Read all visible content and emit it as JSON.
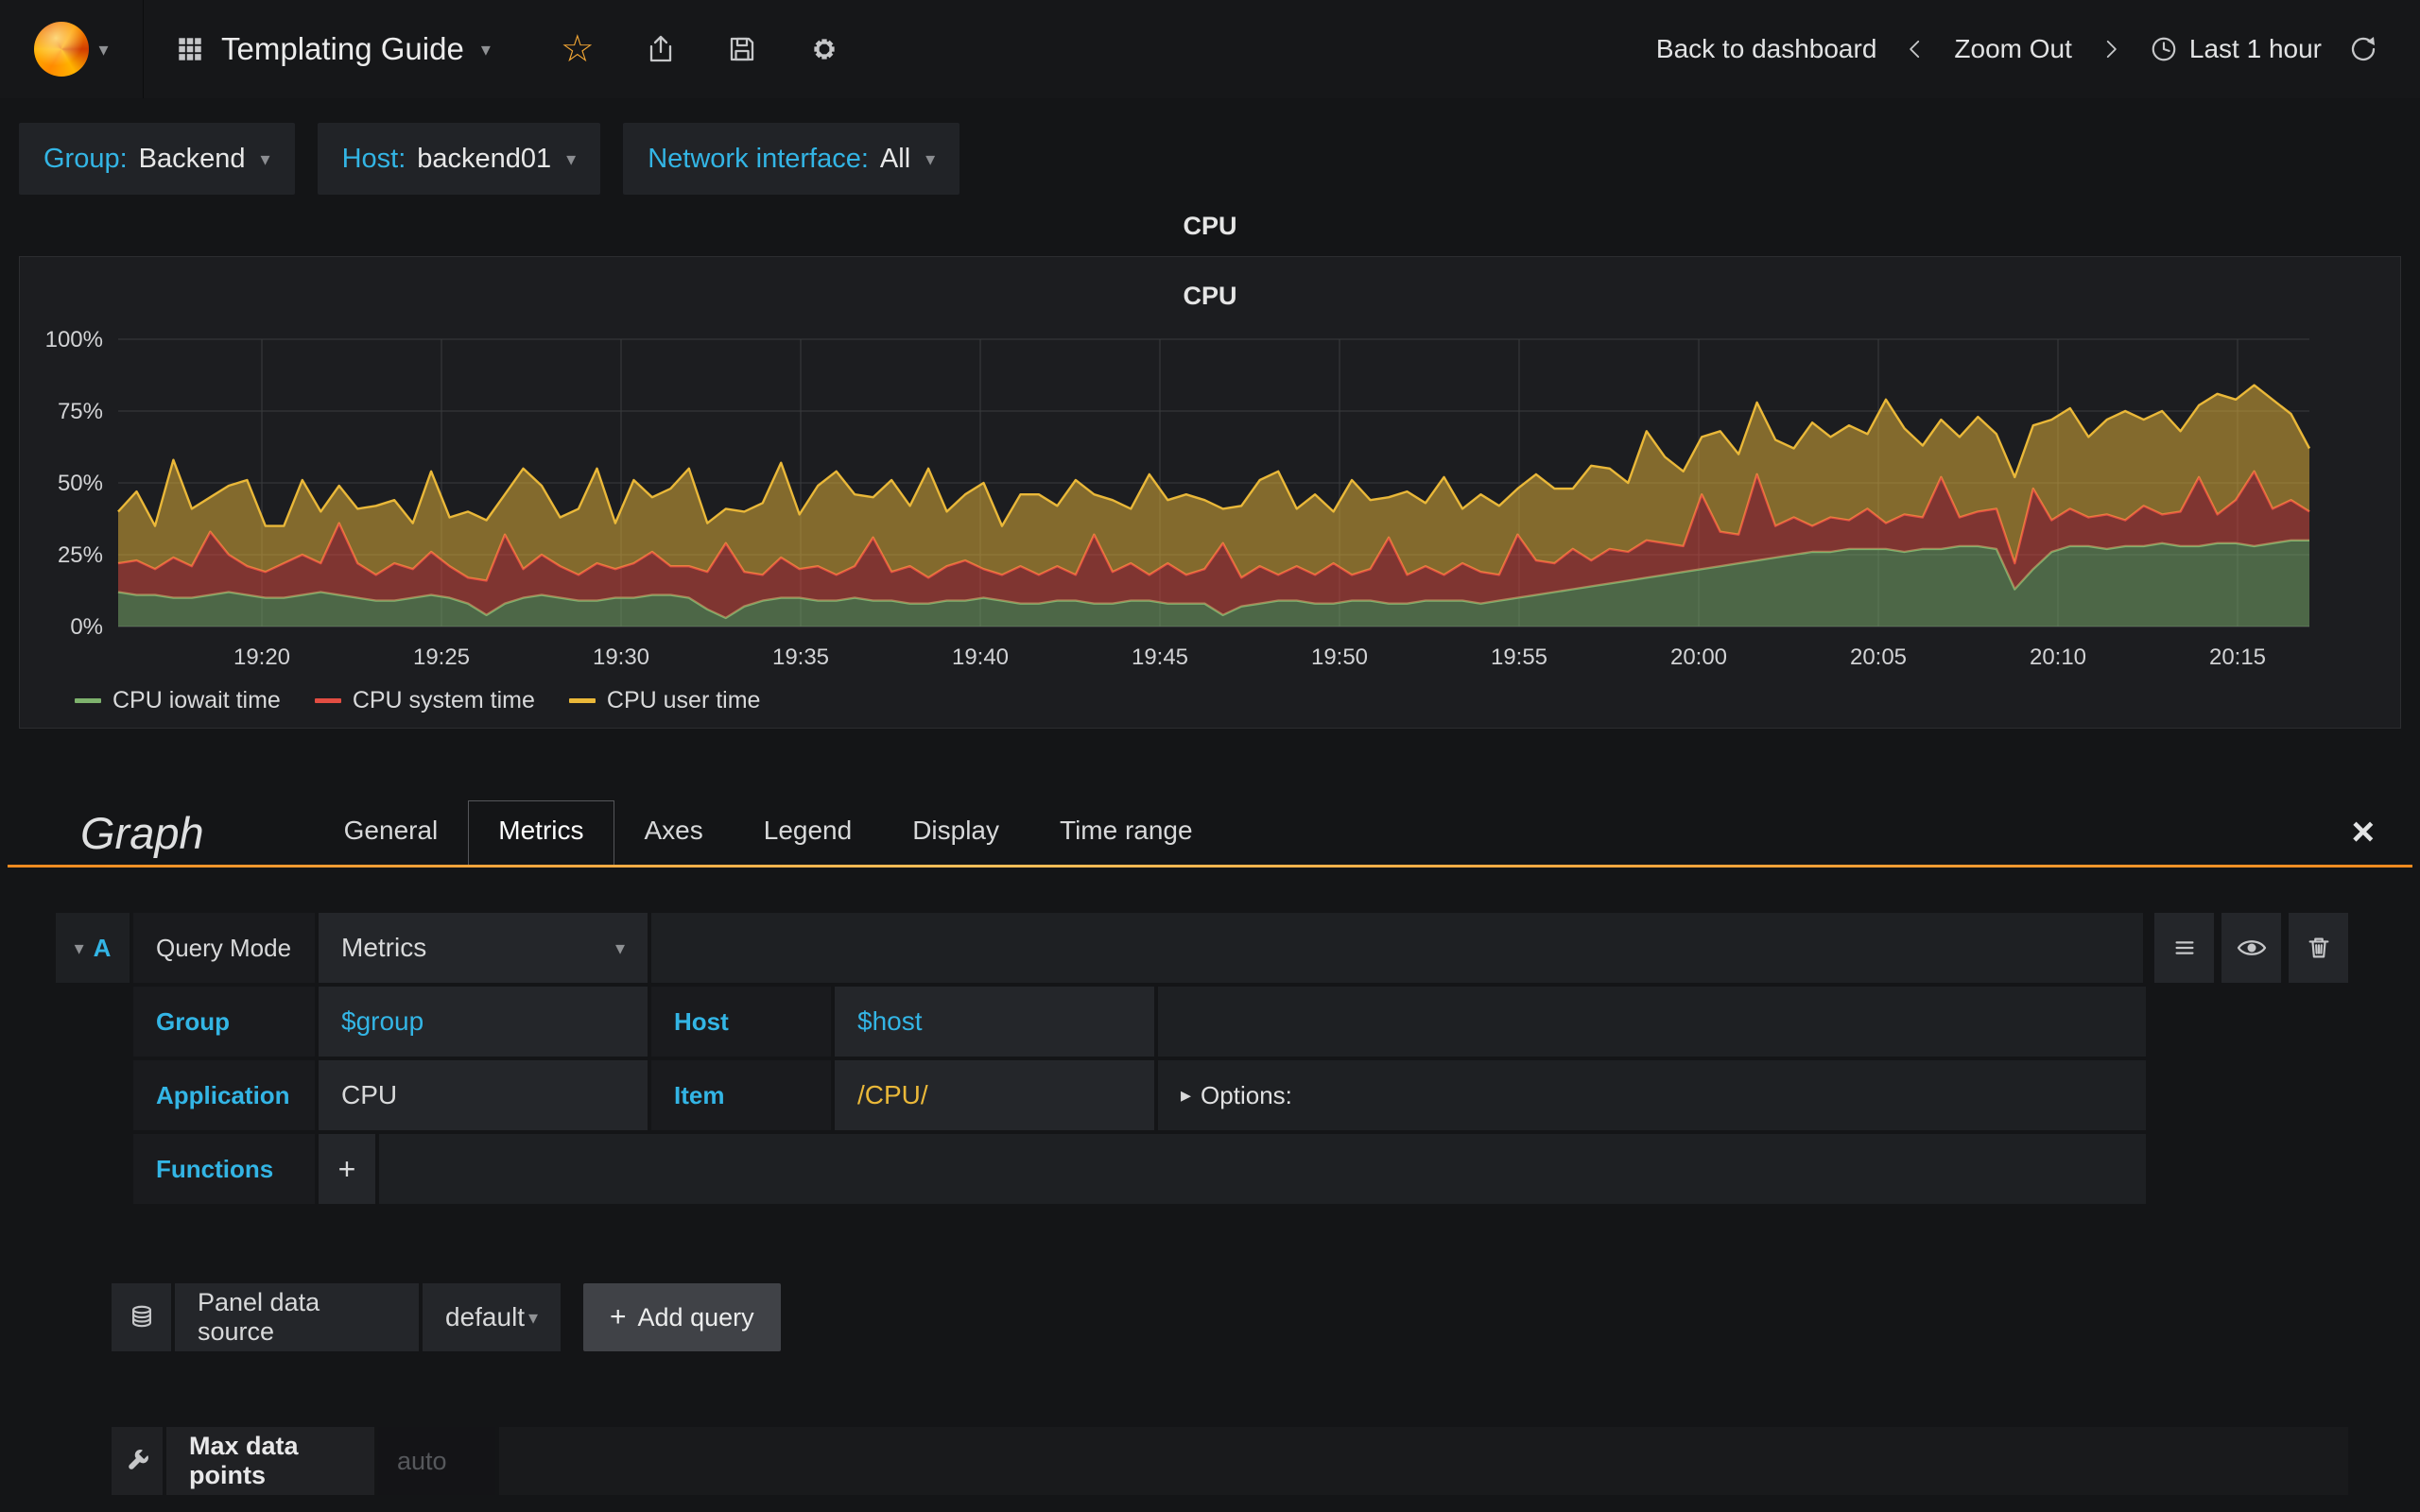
{
  "colors": {
    "accent": "#33b5e5",
    "divider_orange": "#ef8a1f"
  },
  "navbar": {
    "title": "Templating Guide",
    "back_to_dashboard": "Back to dashboard",
    "zoom_out": "Zoom Out",
    "time_range": "Last 1 hour"
  },
  "variables": [
    {
      "label": "Group:",
      "value": "Backend"
    },
    {
      "label": "Host:",
      "value": "backend01"
    },
    {
      "label": "Network interface:",
      "value": "All"
    }
  ],
  "panel": {
    "row_title": "CPU"
  },
  "chart_data": {
    "type": "area",
    "stacked": true,
    "title": "CPU",
    "x_start_time": "19:16",
    "x_end_time": "20:17",
    "duration_minutes": 61,
    "x_ticks": [
      "19:20",
      "19:25",
      "19:30",
      "19:35",
      "19:40",
      "19:45",
      "19:50",
      "19:55",
      "20:00",
      "20:05",
      "20:10",
      "20:15"
    ],
    "x_tick_minutes": [
      4,
      9,
      14,
      19,
      24,
      29,
      34,
      39,
      44,
      49,
      54,
      59
    ],
    "y_ticks": [
      "0%",
      "25%",
      "50%",
      "75%",
      "100%"
    ],
    "y_tick_values": [
      0,
      25,
      50,
      75,
      100
    ],
    "ylim": [
      0,
      100
    ],
    "ylabel": "percent",
    "grid": true,
    "legend_position": "bottom-left",
    "series": [
      {
        "name": "CPU iowait time",
        "color": "#7EB26D",
        "values": [
          12,
          11,
          11,
          10,
          10,
          11,
          12,
          11,
          10,
          10,
          11,
          12,
          11,
          10,
          9,
          9,
          10,
          11,
          10,
          8,
          4,
          8,
          10,
          11,
          10,
          9,
          9,
          10,
          10,
          11,
          11,
          10,
          6,
          3,
          7,
          9,
          10,
          10,
          9,
          9,
          10,
          9,
          9,
          8,
          8,
          9,
          9,
          10,
          9,
          8,
          8,
          9,
          9,
          8,
          8,
          9,
          9,
          8,
          8,
          8,
          4,
          7,
          8,
          9,
          9,
          8,
          8,
          9,
          9,
          8,
          8,
          9,
          9,
          9,
          8,
          9,
          10,
          11,
          12,
          13,
          14,
          15,
          16,
          17,
          18,
          19,
          20,
          21,
          22,
          23,
          24,
          25,
          26,
          26,
          27,
          27,
          27,
          26,
          27,
          27,
          28,
          28,
          27,
          13,
          20,
          26,
          28,
          28,
          27,
          28,
          28,
          29,
          28,
          28,
          29,
          29,
          28,
          29,
          30,
          30
        ]
      },
      {
        "name": "CPU system time",
        "color": "#E24D42",
        "values": [
          10,
          12,
          9,
          14,
          11,
          22,
          13,
          10,
          9,
          12,
          14,
          10,
          25,
          12,
          9,
          13,
          10,
          15,
          11,
          9,
          12,
          24,
          10,
          14,
          11,
          9,
          13,
          10,
          12,
          15,
          10,
          11,
          13,
          26,
          12,
          9,
          14,
          10,
          12,
          9,
          11,
          22,
          10,
          13,
          9,
          12,
          14,
          10,
          9,
          13,
          10,
          12,
          9,
          24,
          11,
          13,
          9,
          14,
          10,
          12,
          25,
          10,
          13,
          9,
          12,
          10,
          14,
          9,
          11,
          23,
          10,
          12,
          9,
          13,
          11,
          9,
          22,
          12,
          10,
          14,
          9,
          12,
          10,
          13,
          11,
          9,
          26,
          12,
          10,
          30,
          11,
          13,
          9,
          12,
          10,
          14,
          9,
          13,
          11,
          25,
          10,
          12,
          14,
          9,
          28,
          11,
          13,
          10,
          12,
          9,
          14,
          10,
          12,
          24,
          10,
          15,
          26,
          12,
          14,
          10
        ]
      },
      {
        "name": "CPU user time",
        "color": "#EAB839",
        "values": [
          18,
          24,
          15,
          34,
          20,
          12,
          24,
          30,
          16,
          13,
          26,
          18,
          13,
          19,
          24,
          22,
          16,
          28,
          17,
          23,
          21,
          14,
          35,
          24,
          17,
          23,
          33,
          16,
          29,
          19,
          27,
          34,
          17,
          12,
          21,
          25,
          33,
          19,
          28,
          36,
          25,
          14,
          32,
          21,
          38,
          19,
          23,
          30,
          17,
          25,
          28,
          21,
          33,
          14,
          25,
          19,
          35,
          22,
          28,
          24,
          12,
          25,
          30,
          36,
          20,
          28,
          18,
          33,
          24,
          14,
          29,
          22,
          34,
          19,
          27,
          24,
          16,
          30,
          26,
          21,
          33,
          28,
          24,
          38,
          30,
          26,
          20,
          35,
          28,
          25,
          30,
          24,
          36,
          28,
          33,
          26,
          43,
          30,
          25,
          20,
          28,
          33,
          26,
          30,
          22,
          35,
          35,
          28,
          33,
          38,
          30,
          36,
          28,
          25,
          42,
          35,
          30,
          38,
          30,
          22
        ]
      }
    ]
  },
  "editor": {
    "panel_type": "Graph",
    "tabs": [
      "General",
      "Metrics",
      "Axes",
      "Legend",
      "Display",
      "Time range"
    ],
    "active_tab": "Metrics",
    "query": {
      "ref": "A",
      "query_mode_label": "Query Mode",
      "query_mode_value": "Metrics",
      "group_label": "Group",
      "group_value": "$group",
      "host_label": "Host",
      "host_value": "$host",
      "application_label": "Application",
      "application_value": "CPU",
      "item_label": "Item",
      "item_value": "/CPU/",
      "options_label": "Options:",
      "functions_label": "Functions",
      "add_function_label": "+"
    },
    "datasource": {
      "label": "Panel data source",
      "value": "default",
      "add_query_label": "Add query"
    },
    "max_data_points": {
      "label": "Max data points",
      "placeholder": "auto"
    }
  }
}
